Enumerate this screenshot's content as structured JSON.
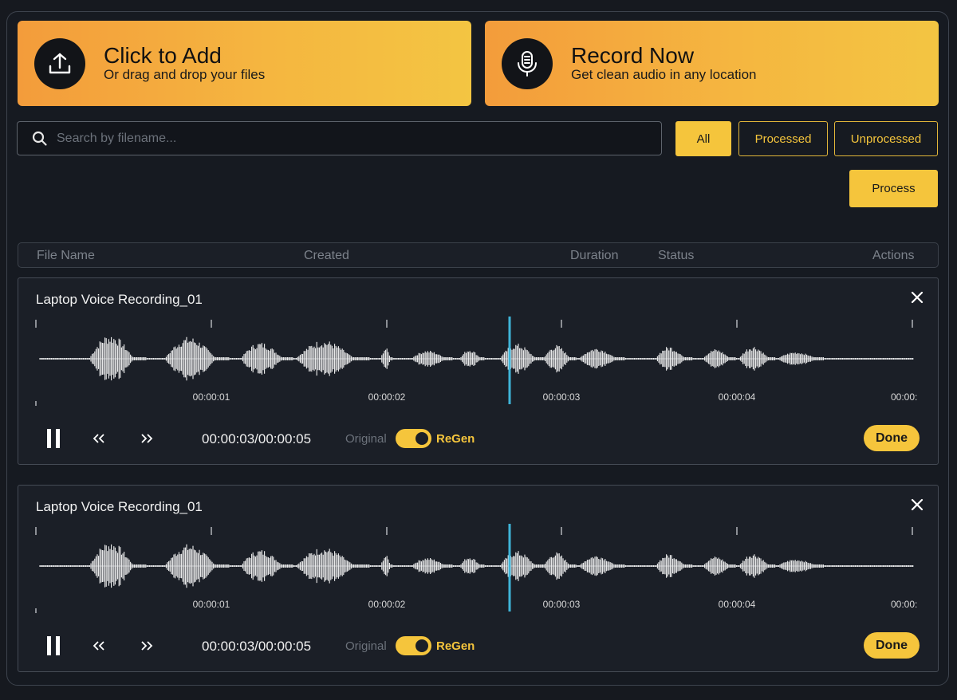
{
  "upload": {
    "title": "Click to Add",
    "subtitle": "Or drag and drop your files",
    "icon": "upload-icon"
  },
  "record": {
    "title": "Record Now",
    "subtitle": "Get clean audio in any location",
    "icon": "microphone-icon"
  },
  "search": {
    "placeholder": "Search by filename..."
  },
  "filters": {
    "all": "All",
    "processed": "Processed",
    "unprocessed": "Unprocessed"
  },
  "process_label": "Process",
  "table": {
    "file_name": "File Name",
    "created": "Created",
    "duration": "Duration",
    "status": "Status",
    "actions": "Actions"
  },
  "recordings": [
    {
      "title": "Laptop Voice Recording_01",
      "ticks": [
        "00:00:01",
        "00:00:02",
        "00:00:03",
        "00:00:04",
        "00:00:"
      ],
      "time": "00:00:03/00:00:05",
      "original_label": "Original",
      "regen_label": "ReGen",
      "done_label": "Done"
    },
    {
      "title": "Laptop Voice Recording_01",
      "ticks": [
        "00:00:01",
        "00:00:02",
        "00:00:03",
        "00:00:04",
        "00:00:"
      ],
      "time": "00:00:03/00:00:05",
      "original_label": "Original",
      "regen_label": "ReGen",
      "done_label": "Done"
    }
  ],
  "colors": {
    "accent": "#f5c53c",
    "playhead": "#3fb4d8",
    "background": "#161a21"
  }
}
